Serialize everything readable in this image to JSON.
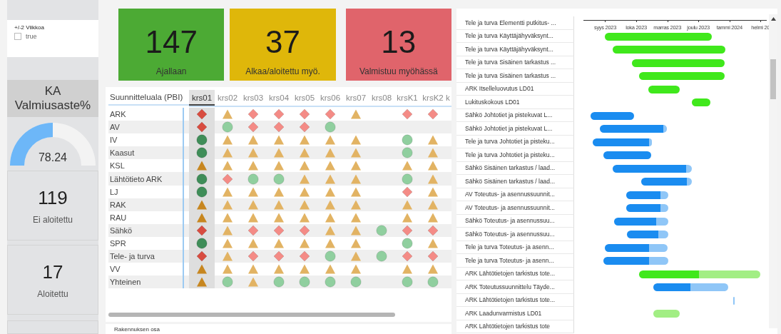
{
  "filter": {
    "title": "+/-2 Viikkoa",
    "options": [
      {
        "label": "true",
        "checked": false
      }
    ]
  },
  "gauge": {
    "title": "KA Valmiusaste%",
    "value": "78.24"
  },
  "cards": [
    {
      "value": "119",
      "label": "Ei aloitettu"
    },
    {
      "value": "17",
      "label": "Aloitettu"
    }
  ],
  "kpis": [
    {
      "value": "147",
      "label": "Ajallaan",
      "kind": "on_time"
    },
    {
      "value": "37",
      "label": "Alkaa/aloitettu myö.",
      "kind": "started"
    },
    {
      "value": "13",
      "label": "Valmistuu myöhässä",
      "kind": "late"
    }
  ],
  "matrix": {
    "corner": "Suunnitteluala (PBI)",
    "columns": [
      {
        "label": "krs01",
        "selected": true
      },
      {
        "label": "krs02",
        "selected": false
      },
      {
        "label": "krs03",
        "selected": false
      },
      {
        "label": "krs04",
        "selected": false
      },
      {
        "label": "krs05",
        "selected": false
      },
      {
        "label": "krs06",
        "selected": false
      },
      {
        "label": "krs07",
        "selected": false
      },
      {
        "label": "krs08",
        "selected": false
      },
      {
        "label": "krsK1",
        "selected": false
      },
      {
        "label": "krsK2",
        "selected": false
      },
      {
        "label": "k",
        "selected": false
      }
    ],
    "rows": [
      {
        "label": "ARK",
        "cells": [
          {
            "kind": "late"
          },
          {
            "kind": "started"
          },
          {
            "kind": "late"
          },
          {
            "kind": "late"
          },
          {
            "kind": "late"
          },
          {
            "kind": "late"
          },
          {
            "kind": "started"
          },
          null,
          {
            "kind": "late"
          },
          {
            "kind": "late"
          }
        ]
      },
      {
        "label": "AV",
        "cells": [
          {
            "kind": "late"
          },
          {
            "kind": "on_time"
          },
          {
            "kind": "late"
          },
          {
            "kind": "late"
          },
          {
            "kind": "late"
          },
          {
            "kind": "on_time"
          },
          null,
          null,
          null,
          null
        ]
      },
      {
        "label": "IV",
        "cells": [
          {
            "kind": "on_time"
          },
          {
            "kind": "started"
          },
          {
            "kind": "started"
          },
          {
            "kind": "started"
          },
          {
            "kind": "started"
          },
          {
            "kind": "started"
          },
          {
            "kind": "started"
          },
          null,
          {
            "kind": "on_time"
          },
          {
            "kind": "started"
          }
        ]
      },
      {
        "label": "Kaasut",
        "cells": [
          {
            "kind": "on_time"
          },
          {
            "kind": "started"
          },
          {
            "kind": "started"
          },
          {
            "kind": "started"
          },
          {
            "kind": "started"
          },
          {
            "kind": "started"
          },
          {
            "kind": "started"
          },
          null,
          {
            "kind": "on_time"
          },
          {
            "kind": "started"
          }
        ]
      },
      {
        "label": "KSL",
        "cells": [
          {
            "kind": "started"
          },
          {
            "kind": "started"
          },
          {
            "kind": "started"
          },
          {
            "kind": "started"
          },
          {
            "kind": "started"
          },
          {
            "kind": "started"
          },
          {
            "kind": "started"
          },
          null,
          {
            "kind": "started"
          },
          {
            "kind": "started"
          }
        ]
      },
      {
        "label": "Lähtötieto ARK",
        "cells": [
          {
            "kind": "on_time"
          },
          {
            "kind": "late"
          },
          {
            "kind": "on_time"
          },
          {
            "kind": "on_time"
          },
          {
            "kind": "started"
          },
          {
            "kind": "started"
          },
          {
            "kind": "started"
          },
          null,
          {
            "kind": "on_time"
          },
          {
            "kind": "started"
          }
        ]
      },
      {
        "label": "LJ",
        "cells": [
          {
            "kind": "on_time"
          },
          {
            "kind": "started"
          },
          {
            "kind": "started"
          },
          {
            "kind": "started"
          },
          {
            "kind": "started"
          },
          {
            "kind": "started"
          },
          {
            "kind": "started"
          },
          null,
          {
            "kind": "late"
          },
          {
            "kind": "started"
          }
        ]
      },
      {
        "label": "RAK",
        "cells": [
          {
            "kind": "started"
          },
          {
            "kind": "started"
          },
          {
            "kind": "started"
          },
          {
            "kind": "started"
          },
          {
            "kind": "started"
          },
          {
            "kind": "started"
          },
          {
            "kind": "started"
          },
          null,
          {
            "kind": "started"
          },
          {
            "kind": "started"
          }
        ]
      },
      {
        "label": "RAU",
        "cells": [
          {
            "kind": "started"
          },
          {
            "kind": "started"
          },
          {
            "kind": "started"
          },
          {
            "kind": "started"
          },
          {
            "kind": "started"
          },
          {
            "kind": "started"
          },
          {
            "kind": "started"
          },
          null,
          {
            "kind": "started"
          },
          {
            "kind": "started"
          }
        ]
      },
      {
        "label": "Sähkö",
        "cells": [
          {
            "kind": "late"
          },
          {
            "kind": "started"
          },
          {
            "kind": "late"
          },
          {
            "kind": "late"
          },
          {
            "kind": "late"
          },
          {
            "kind": "started"
          },
          {
            "kind": "started"
          },
          {
            "kind": "on_time"
          },
          {
            "kind": "late"
          },
          {
            "kind": "late"
          }
        ]
      },
      {
        "label": "SPR",
        "cells": [
          {
            "kind": "on_time"
          },
          {
            "kind": "started"
          },
          {
            "kind": "started"
          },
          {
            "kind": "started"
          },
          {
            "kind": "started"
          },
          {
            "kind": "started"
          },
          {
            "kind": "started"
          },
          null,
          {
            "kind": "on_time"
          },
          {
            "kind": "started"
          }
        ]
      },
      {
        "label": "Tele- ja turva",
        "cells": [
          {
            "kind": "late"
          },
          {
            "kind": "started"
          },
          {
            "kind": "late"
          },
          {
            "kind": "late"
          },
          {
            "kind": "late"
          },
          {
            "kind": "on_time"
          },
          {
            "kind": "started"
          },
          {
            "kind": "on_time"
          },
          {
            "kind": "late"
          },
          {
            "kind": "late"
          }
        ]
      },
      {
        "label": "VV",
        "cells": [
          {
            "kind": "started"
          },
          {
            "kind": "started"
          },
          {
            "kind": "started"
          },
          {
            "kind": "started"
          },
          {
            "kind": "started"
          },
          {
            "kind": "started"
          },
          {
            "kind": "started"
          },
          null,
          {
            "kind": "started"
          },
          {
            "kind": "started"
          }
        ]
      },
      {
        "label": "Yhteinen",
        "cells": [
          {
            "kind": "started"
          },
          {
            "kind": "on_time"
          },
          {
            "kind": "started"
          },
          {
            "kind": "on_time"
          },
          {
            "kind": "on_time"
          },
          {
            "kind": "on_time"
          },
          {
            "kind": "on_time"
          },
          null,
          {
            "kind": "on_time"
          },
          {
            "kind": "on_time"
          }
        ]
      }
    ],
    "footer_label": "Rakennuksen osa"
  },
  "gantt": {
    "axis_labels": [
      "syys 2023",
      "loka 2023",
      "marras 2023",
      "joulu 2023",
      "tammi 2024",
      "helmi 20"
    ],
    "tasks": [
      "Tele ja turva Elementti putkitus- ...",
      "Tele ja turva Käyttäjähyväksynt...",
      "Tele ja turva Käyttäjähyväksynt...",
      "Tele ja turva Sisäinen tarkastus ...",
      "Tele ja turva Sisäinen tarkastus ...",
      "ARK Itselleluovutus LD01",
      "Lukituskokous LD01",
      "Sähkö Johtotiet ja pistekuvat L...",
      "Sähkö Johtotiet ja pistekuvat L...",
      "Tele ja turva Johtotiet ja pisteku...",
      "Tele ja turva Johtotiet ja pisteku...",
      "Sähkö Sisäinen tarkastus / laad...",
      "Sähkö Sisäinen tarkastus / laad...",
      "AV Toteutus- ja asennussuunnit...",
      "AV Toteutus- ja asennussuunnit...",
      "Sähkö Toteutus- ja asennussuu...",
      "Sähkö Toteutus- ja asennussuu...",
      "Tele ja turva Toteutus- ja asenn...",
      "Tele ja turva Toteutus- ja asenn...",
      "ARK Lähtötietojen tarkistus tote...",
      "ARK Toteutussuunnittelu Täyde...",
      "ARK Lähtötietojen tarkistus tote...",
      "ARK Laadunvarmistus LD01",
      "ARK Lähtötietojen tarkistus tote"
    ]
  }
}
